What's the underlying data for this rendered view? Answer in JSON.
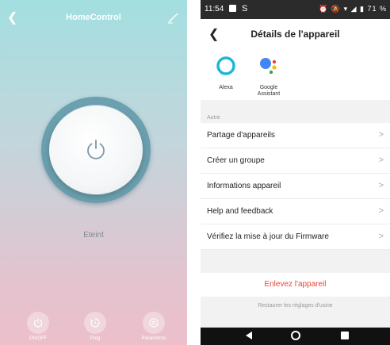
{
  "left_app": {
    "title": "HomeControl",
    "back_icon": "chevron-left-icon",
    "edit_icon": "pencil-icon",
    "power_icon": "power-icon",
    "state_text": "Eteint",
    "bottom_buttons": [
      {
        "label": "ON/OFF",
        "icon": "power-icon"
      },
      {
        "label": "Prog",
        "icon": "timer-icon"
      },
      {
        "label": "Paramètres",
        "icon": "settings-icon"
      }
    ],
    "colors": {
      "gradient_top": "#a3dfe0",
      "gradient_bottom": "#ecbfcb"
    }
  },
  "status_bar": {
    "time": "11:54",
    "carrier_letter": "S",
    "icons": "⏰ 🔕 ▾ ◢ ▮ 71 %"
  },
  "right_app": {
    "title": "Détails de l'appareil",
    "back_icon": "chevron-left-icon",
    "assistants": [
      {
        "label": "Alexa",
        "icon": "alexa-icon"
      },
      {
        "label": "Google\nAssistant",
        "icon": "google-assistant-icon"
      }
    ],
    "section_label": "Autre",
    "menu": [
      {
        "label": "Partage d'appareils"
      },
      {
        "label": "Créer un groupe"
      },
      {
        "label": "Informations appareil"
      },
      {
        "label": "Help and feedback"
      },
      {
        "label": "Vérifiez la mise à jour du Firmware"
      }
    ],
    "chevron": ">",
    "remove_label": "Enlevez l'appareil",
    "restore_label": "Restaurer les réglages d'usine",
    "colors": {
      "remove": "#e8463a",
      "alexa": "#1fb5d9"
    }
  },
  "nav_bar": {
    "back_icon": "nav-back-icon",
    "home_icon": "nav-home-icon",
    "recents_icon": "nav-recents-icon"
  }
}
